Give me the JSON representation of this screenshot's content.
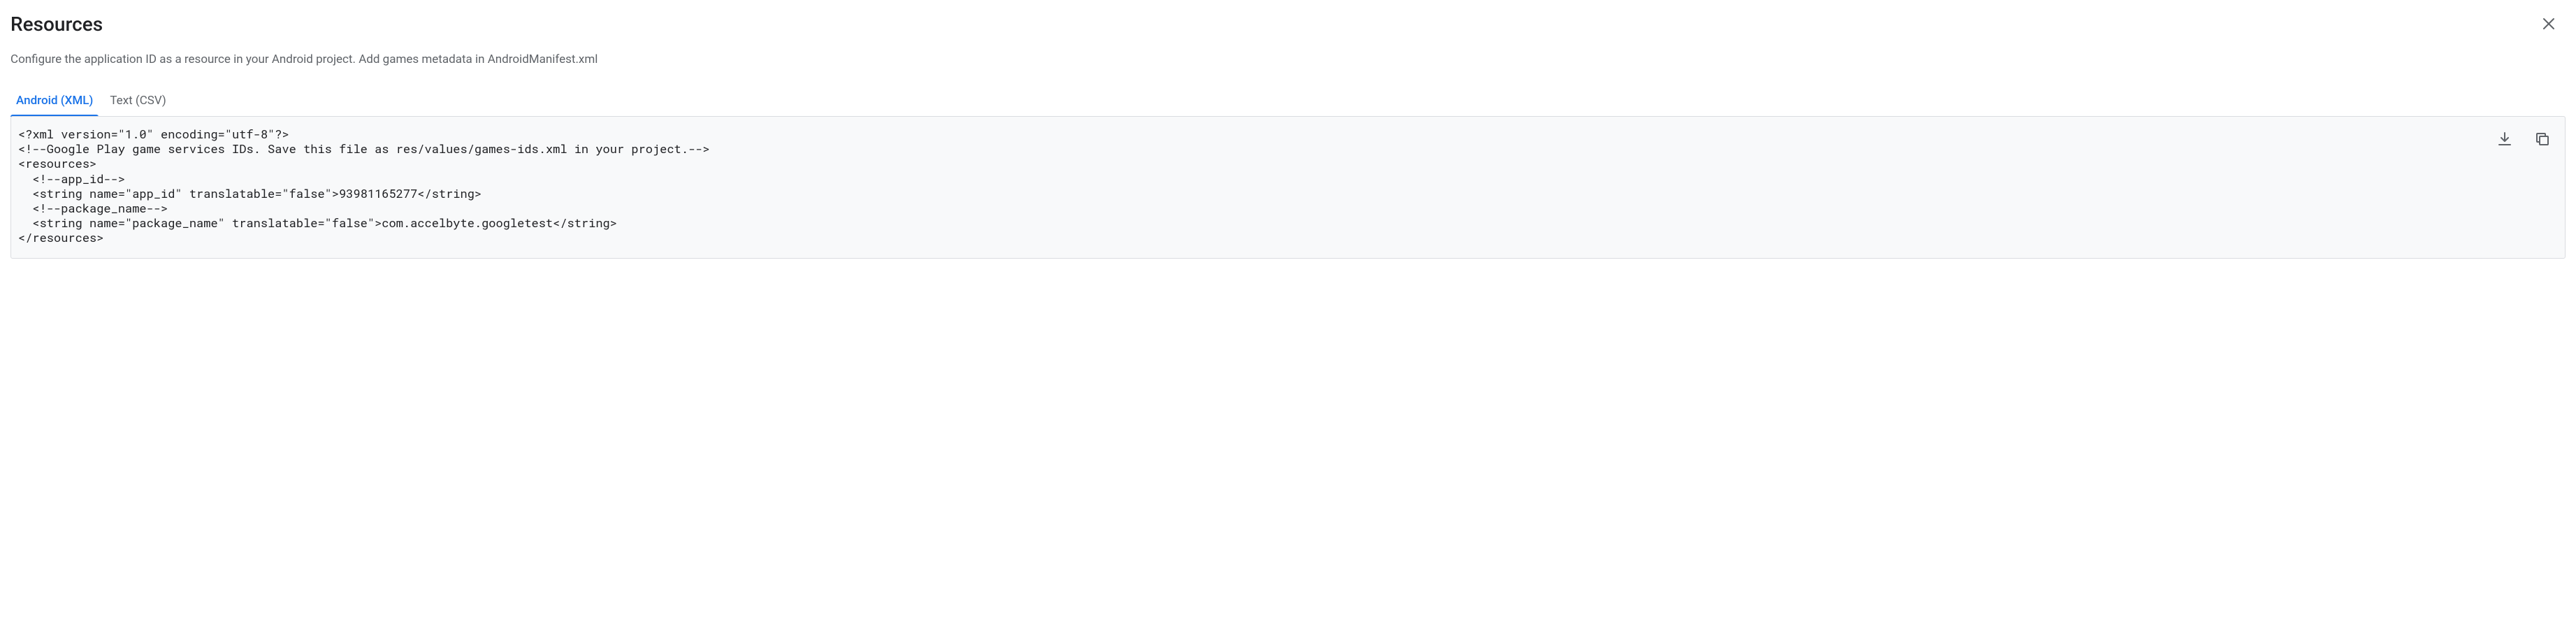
{
  "title": "Resources",
  "subtitle": "Configure the application ID as a resource in your Android project. Add games metadata in AndroidManifest.xml",
  "tabs": {
    "android": "Android (XML)",
    "text": "Text (CSV)"
  },
  "code": "<?xml version=\"1.0\" encoding=\"utf-8\"?>\n<!--Google Play game services IDs. Save this file as res/values/games-ids.xml in your project.-->\n<resources>\n  <!--app_id-->\n  <string name=\"app_id\" translatable=\"false\">93981165277</string>\n  <!--package_name-->\n  <string name=\"package_name\" translatable=\"false\">com.accelbyte.googletest</string>\n</resources>",
  "icons": {
    "close": "close-icon",
    "download": "download-icon",
    "copy": "copy-icon"
  }
}
